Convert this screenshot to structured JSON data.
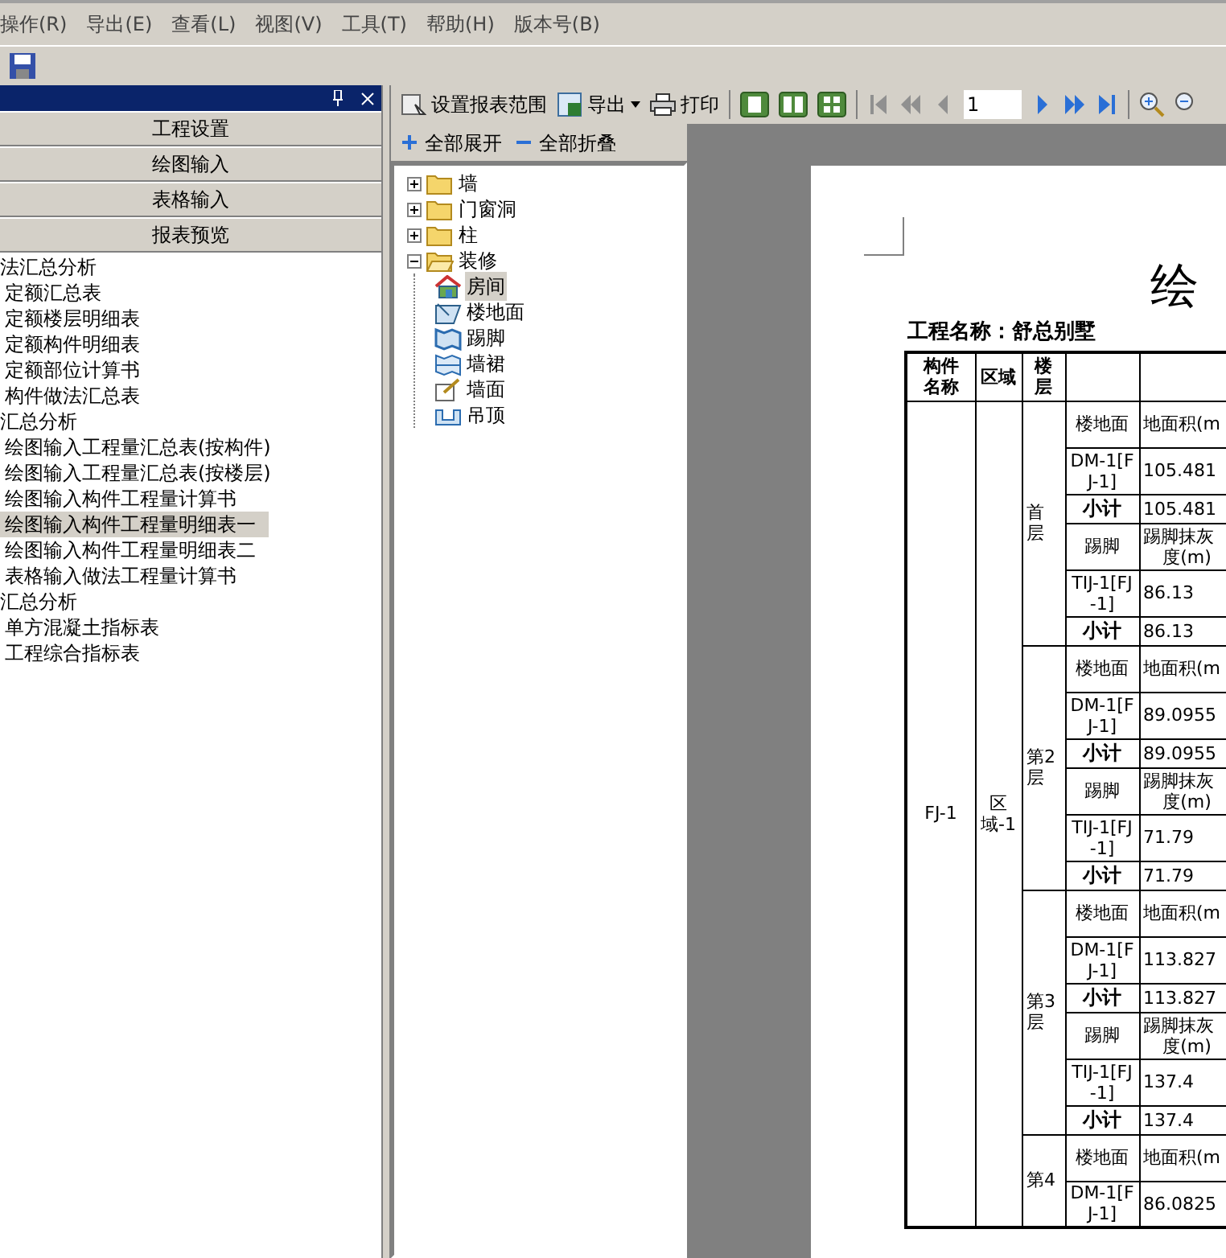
{
  "menu": [
    "操作(R)",
    "导出(E)",
    "查看(L)",
    "视图(V)",
    "工具(T)",
    "帮助(H)",
    "版本号(B)"
  ],
  "left_panel": {
    "buttons": [
      "工程设置",
      "绘图输入",
      "表格输入",
      "报表预览"
    ],
    "report_list": [
      {
        "label": "法汇总分析",
        "kind": "group",
        "selected": false
      },
      {
        "label": "定额汇总表",
        "kind": "item",
        "selected": false
      },
      {
        "label": "定额楼层明细表",
        "kind": "item",
        "selected": false
      },
      {
        "label": "定额构件明细表",
        "kind": "item",
        "selected": false
      },
      {
        "label": "定额部位计算书",
        "kind": "item",
        "selected": false
      },
      {
        "label": "构件做法汇总表",
        "kind": "item",
        "selected": false
      },
      {
        "label": "汇总分析",
        "kind": "group",
        "selected": false
      },
      {
        "label": "绘图输入工程量汇总表(按构件)",
        "kind": "item",
        "selected": false
      },
      {
        "label": "绘图输入工程量汇总表(按楼层)",
        "kind": "item",
        "selected": false
      },
      {
        "label": "绘图输入构件工程量计算书",
        "kind": "item",
        "selected": false
      },
      {
        "label": "绘图输入构件工程量明细表一",
        "kind": "item",
        "selected": true
      },
      {
        "label": "绘图输入构件工程量明细表二",
        "kind": "item",
        "selected": false
      },
      {
        "label": "表格输入做法工程量计算书",
        "kind": "item",
        "selected": false
      },
      {
        "label": "汇总分析",
        "kind": "group",
        "selected": false
      },
      {
        "label": "单方混凝土指标表",
        "kind": "item",
        "selected": false
      },
      {
        "label": "工程综合指标表",
        "kind": "item",
        "selected": false
      }
    ]
  },
  "toolbar": {
    "set_range": "设置报表范围",
    "export": "导出",
    "print": "打印",
    "page": "1"
  },
  "tree_toolbar": {
    "expand_all": "全部展开",
    "collapse_all": "全部折叠"
  },
  "tree": [
    {
      "label": "墙",
      "expanded": false
    },
    {
      "label": "门窗洞",
      "expanded": false
    },
    {
      "label": "柱",
      "expanded": false
    },
    {
      "label": "装修",
      "expanded": true,
      "children": [
        {
          "label": "房间",
          "kind": "room",
          "selected": true
        },
        {
          "label": "楼地面",
          "kind": "floor",
          "selected": false
        },
        {
          "label": "踢脚",
          "kind": "skirting",
          "selected": false
        },
        {
          "label": "墙裙",
          "kind": "dado",
          "selected": false
        },
        {
          "label": "墙面",
          "kind": "wall",
          "selected": false
        },
        {
          "label": "吊顶",
          "kind": "ceiling",
          "selected": false
        }
      ]
    }
  ],
  "report": {
    "title": "绘",
    "project": "工程名称：舒总别墅",
    "columns": [
      "构件名称",
      "区域",
      "楼层"
    ],
    "component": "FJ-1",
    "region": "区域-1",
    "floors": [
      {
        "label": "首层",
        "rows": [
          {
            "kind": "item",
            "name": "楼地面",
            "value": "地面积(m"
          },
          {
            "kind": "item",
            "name": "DM-1[FJ-1]",
            "value": "105.481"
          },
          {
            "kind": "subtotal",
            "name": "小计",
            "value": "105.481"
          },
          {
            "kind": "item",
            "name": "踢脚",
            "value": [
              "踢脚抹灰",
              "度(m)"
            ]
          },
          {
            "kind": "item",
            "name": "TIJ-1[FJ-1]",
            "value": "86.13"
          },
          {
            "kind": "subtotal",
            "name": "小计",
            "value": "86.13"
          }
        ]
      },
      {
        "label": "第2层",
        "rows": [
          {
            "kind": "item",
            "name": "楼地面",
            "value": "地面积(m"
          },
          {
            "kind": "item",
            "name": "DM-1[FJ-1]",
            "value": "89.0955"
          },
          {
            "kind": "subtotal",
            "name": "小计",
            "value": "89.0955"
          },
          {
            "kind": "item",
            "name": "踢脚",
            "value": [
              "踢脚抹灰",
              "度(m)"
            ]
          },
          {
            "kind": "item",
            "name": "TIJ-1[FJ-1]",
            "value": "71.79"
          },
          {
            "kind": "subtotal",
            "name": "小计",
            "value": "71.79"
          }
        ]
      },
      {
        "label": "第3层",
        "rows": [
          {
            "kind": "item",
            "name": "楼地面",
            "value": "地面积(m"
          },
          {
            "kind": "item",
            "name": "DM-1[FJ-1]",
            "value": "113.827"
          },
          {
            "kind": "subtotal",
            "name": "小计",
            "value": "113.827"
          },
          {
            "kind": "item",
            "name": "踢脚",
            "value": [
              "踢脚抹灰",
              "度(m)"
            ]
          },
          {
            "kind": "item",
            "name": "TIJ-1[FJ-1]",
            "value": "137.4"
          },
          {
            "kind": "subtotal",
            "name": "小计",
            "value": "137.4"
          }
        ]
      },
      {
        "label": "第4",
        "rows": [
          {
            "kind": "item",
            "name": "楼地面",
            "value": "地面积(m"
          },
          {
            "kind": "item",
            "name": "DM-1[FJ-1]",
            "value": "86.0825"
          }
        ]
      }
    ]
  }
}
